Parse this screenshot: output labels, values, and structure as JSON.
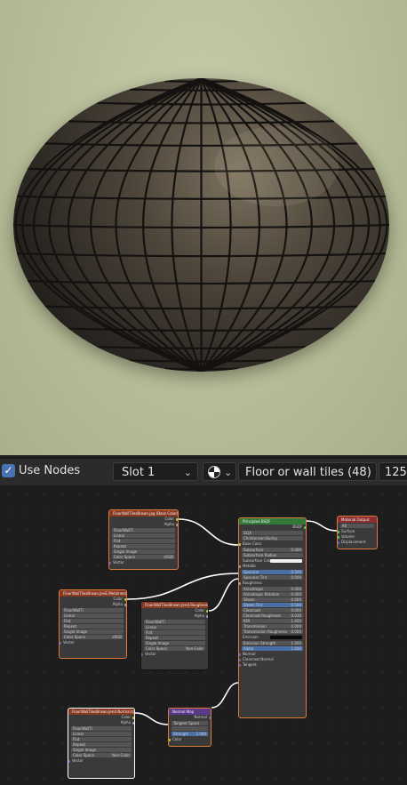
{
  "header": {
    "use_nodes_label": "Use Nodes",
    "use_nodes_checked": true,
    "slot_label": "Slot 1",
    "material_name": "Floor or wall tiles (48)",
    "user_count": "125"
  },
  "nodes": {
    "base_color_tex": {
      "title": "FloorWallTilesBrown.jpg (Base Color)",
      "out_color": "Color",
      "out_alpha": "Alpha",
      "image_name": "FloorWallTi",
      "interpolation": "Linear",
      "projection": "Flat",
      "extension": "Repeat",
      "source": "Single Image",
      "color_space_label": "Color Space",
      "color_space": "sRGB",
      "in_vector": "Vector"
    },
    "metal_tex": {
      "title": "FloorWallTilesBrown.JenE.Metalness",
      "out_color": "Color",
      "out_alpha": "Alpha",
      "image_name": "FloorWallTi",
      "interpolation": "Linear",
      "projection": "Flat",
      "extension": "Repeat",
      "source": "Single Image",
      "color_space_label": "Color Space",
      "color_space": "sRGB",
      "in_vector": "Vector"
    },
    "rough_tex": {
      "title": "FloorWallTilesBrown.Jen4.Roughness",
      "out_color": "Color",
      "out_alpha": "Alpha",
      "image_name": "FloorWallTi",
      "interpolation": "Linear",
      "projection": "Flat",
      "extension": "Repeat",
      "source": "Single Image",
      "color_space_label": "Color Space",
      "color_space": "Non-Color",
      "in_vector": "Vector"
    },
    "normal_tex": {
      "title": "FloorWallTilesBrown.Jen4.Normal.tga",
      "out_color": "Color",
      "out_alpha": "Alpha",
      "image_name": "FloorWallTi",
      "interpolation": "Linear",
      "projection": "Flat",
      "extension": "Repeat",
      "source": "Single Image",
      "color_space_label": "Color Space",
      "color_space": "Non-Color",
      "in_vector": "Vector"
    },
    "normal_map": {
      "title": "Normal Map",
      "out_normal": "Normal",
      "space": "Tangent Space",
      "strength_label": "Strength",
      "strength": "1.000",
      "in_color": "Color"
    },
    "bsdf": {
      "title": "Principled BSDF",
      "out_bsdf": "BSDF",
      "distribution": "GGX",
      "subsurface_method": "Christensen-Burley",
      "base_color": "Base Color",
      "subsurface": "Subsurface",
      "subsurface_val": "0.000",
      "subsurface_radius": "Subsurface Radius",
      "subsurface_color": "Subsurface Color",
      "metallic": "Metallic",
      "specular": "Specular",
      "specular_val": "0.500",
      "specular_tint": "Specular Tint",
      "specular_tint_val": "0.000",
      "roughness": "Roughness",
      "anisotropic": "Anisotropic",
      "anisotropic_val": "0.000",
      "anisotropic_rotation": "Anisotropic Rotation",
      "anisotropic_rotation_val": "0.000",
      "sheen": "Sheen",
      "sheen_val": "0.000",
      "sheen_tint": "Sheen Tint",
      "sheen_tint_val": "0.500",
      "clearcoat": "Clearcoat",
      "clearcoat_val": "0.000",
      "clearcoat_roughness": "Clearcoat Roughness",
      "clearcoat_roughness_val": "0.030",
      "ior": "IOR",
      "ior_val": "1.450",
      "transmission": "Transmission",
      "transmission_val": "0.000",
      "transmission_roughness": "Transmission Roughness",
      "transmission_roughness_val": "0.000",
      "emission": "Emission",
      "emission_strength": "Emission Strength",
      "emission_strength_val": "1.000",
      "alpha": "Alpha",
      "alpha_val": "1.000",
      "normal": "Normal",
      "clearcoat_normal": "Clearcoat Normal",
      "tangent": "Tangent"
    },
    "output": {
      "title": "Material Output",
      "target": "All",
      "surface": "Surface",
      "volume": "Volume",
      "displacement": "Displacement"
    }
  },
  "colors": {
    "accent_blue": "#4772b3",
    "texture_header": "#8a3a21",
    "shader_header": "#327a38",
    "vector_header": "#5b3a8e",
    "output_header": "#8c2e2e",
    "selected_outline": "#e07a3a",
    "wire": "#ffffff"
  }
}
